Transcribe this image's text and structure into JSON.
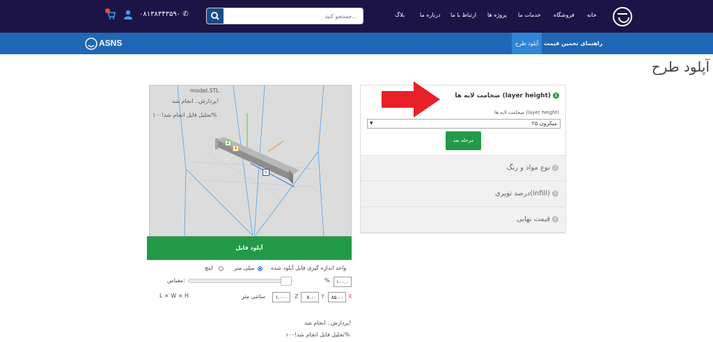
{
  "header": {
    "nav": [
      "خانه",
      "فروشگاه",
      "خدمات ما",
      "پروژه ها",
      "ارتباط با ما",
      "درباره ما",
      "بلاگ"
    ],
    "search_placeholder": "جستجو کنید...",
    "phone": "۰۸۱۳۸۳۴۳۵۹۰",
    "cart_count": "0"
  },
  "subnav": {
    "active": "آپلود طرح",
    "item": "راهنمای تخمین قیمت",
    "brand": "ASNS"
  },
  "page": {
    "title": "آپلود طرح"
  },
  "viewer": {
    "filename": "model.STL",
    "status1": "پردازش.. انجام شد!",
    "status2": "تحلیل فایل انجام شد!۱۰۰%",
    "axis_z": "Z",
    "axis_x": "X",
    "axis_y": "Y"
  },
  "upload": {
    "button": "آپلود فایل",
    "unit_label": "واحد اندازه گیری فایل آپلود شده",
    "unit_mm": "میلی متر",
    "unit_inch": "اینچ",
    "percent_sign": "%",
    "scale_value": "۱۰۰.۰۰",
    "scale_label": "مقیاس:",
    "dim_x": "۸۵.۰۰",
    "dim_y": "۷.۰۰",
    "dim_z": "۱.۰۰۰",
    "dim_x_label": "X",
    "dim_y_label": "Y",
    "dim_z_label": "Z",
    "dim_unit": "سانتی متر",
    "dims_hint": "L × W × H",
    "status1": "پردازش.. انجام شد!",
    "status2": "تحلیل فایل انجام شد!۱۰۰%"
  },
  "accordion": {
    "step1_num": "1",
    "step1_title": "ضخامت لایه ها (layer height)",
    "step1_field_label": "ضخامت لایه ها (layer height)",
    "step1_value": "۲۵ میکرون",
    "next": "مرحله بعد",
    "step2_num": "2",
    "step2": "نوع مواد و رنگ",
    "step3_num": "3",
    "step3": "درصد توپری(infill)",
    "step4_num": "4",
    "step4": "قیمت نهایی"
  },
  "colors": {
    "dark": "#1c1446",
    "blue": "#1f68b5",
    "green": "#239a48",
    "arrow": "#e8202a"
  }
}
